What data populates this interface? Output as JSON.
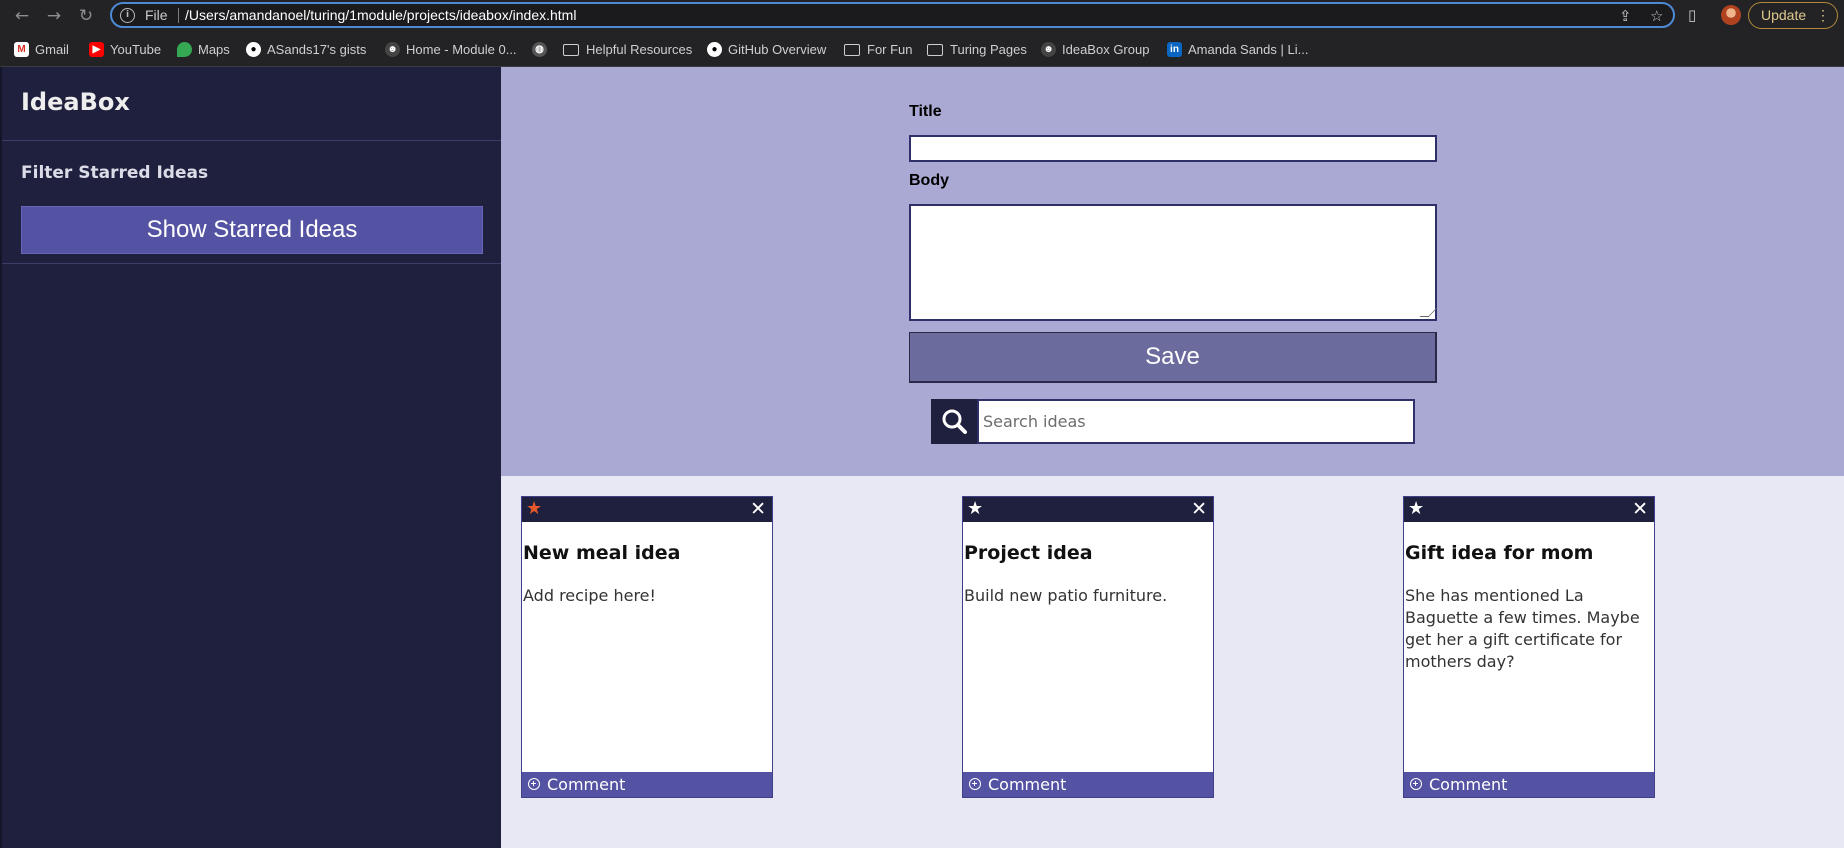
{
  "browser": {
    "nav": {
      "back": "←",
      "forward": "→",
      "reload": "↻"
    },
    "omnibox": {
      "scheme_label": "File",
      "url": "/Users/amandanoel/turing/1module/projects/ideabox/index.html"
    },
    "update_label": "Update"
  },
  "bookmarks": [
    {
      "label": "Gmail",
      "icon": "gmail-icon"
    },
    {
      "label": "YouTube",
      "icon": "youtube-icon"
    },
    {
      "label": "Maps",
      "icon": "maps-icon"
    },
    {
      "label": "ASands17's gists",
      "icon": "github-icon"
    },
    {
      "label": "Home - Module 0...",
      "icon": "turing-icon"
    },
    {
      "label": "",
      "icon": "globe-icon"
    },
    {
      "label": "Helpful Resources",
      "icon": "folder-icon"
    },
    {
      "label": "GitHub Overview",
      "icon": "github-icon"
    },
    {
      "label": "For Fun",
      "icon": "folder-icon"
    },
    {
      "label": "Turing Pages",
      "icon": "folder-icon"
    },
    {
      "label": "IdeaBox Group",
      "icon": "turing-icon"
    },
    {
      "label": "Amanda Sands | Li...",
      "icon": "linkedin-icon"
    }
  ],
  "sidebar": {
    "brand": "IdeaBox",
    "filter_heading": "Filter Starred Ideas",
    "filter_button": "Show Starred Ideas"
  },
  "form": {
    "title_label": "Title",
    "title_value": "",
    "body_label": "Body",
    "body_value": "",
    "save_label": "Save",
    "search_placeholder": "Search ideas"
  },
  "cards": [
    {
      "title": "New meal idea",
      "body": "Add recipe here!",
      "starred": true,
      "comment_label": "Comment"
    },
    {
      "title": "Project idea",
      "body": "Build new patio furniture.",
      "starred": false,
      "comment_label": "Comment"
    },
    {
      "title": "Gift idea for mom",
      "body": "She has mentioned La Baguette a few times. Maybe get her a gift certificate for mothers day?",
      "starred": false,
      "comment_label": "Comment"
    }
  ],
  "colors": {
    "sidebar_bg": "#1f1f3e",
    "form_bg": "#a9a9d3",
    "button_purple": "#5452a2",
    "save_bg": "#6b6b9e",
    "star_active": "#e5592b",
    "star_inactive": "#ffffff"
  }
}
